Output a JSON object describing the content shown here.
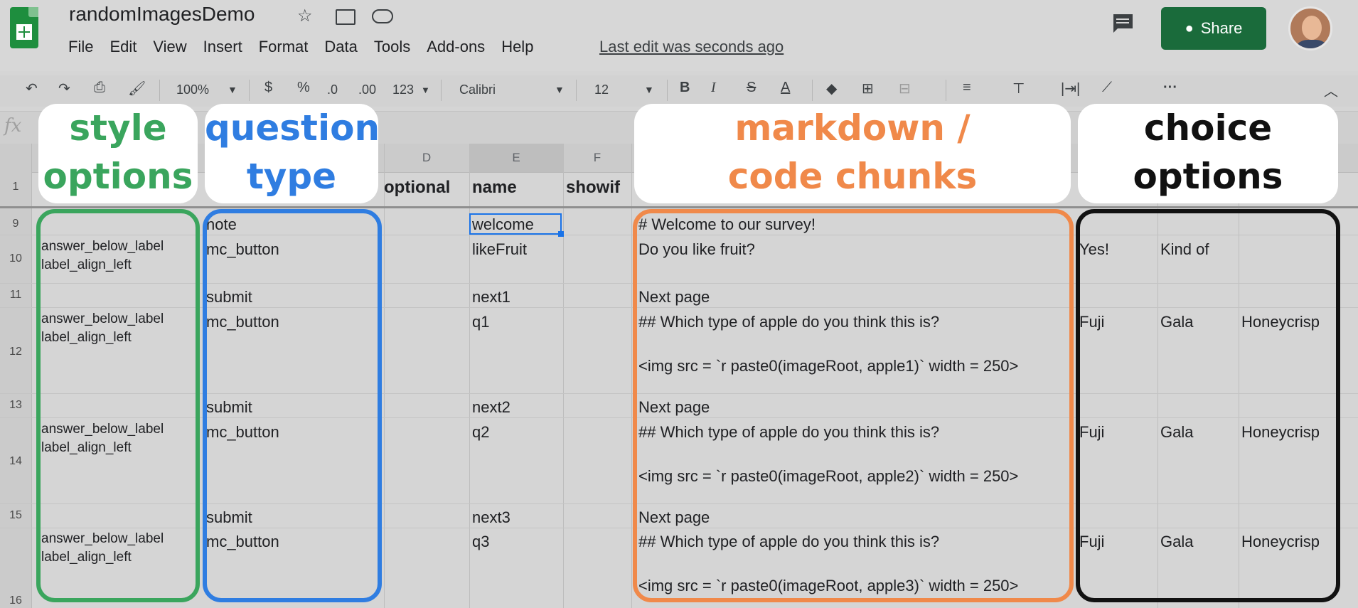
{
  "app": {
    "title": "randomImagesDemo",
    "menu": [
      "File",
      "Edit",
      "View",
      "Insert",
      "Format",
      "Data",
      "Tools",
      "Add-ons",
      "Help"
    ],
    "last_edit": "Last edit was seconds ago",
    "share_label": "Share"
  },
  "toolbar": {
    "zoom": "100%",
    "currency": "$",
    "percent": "%",
    "dec_less": ".0",
    "dec_more": ".00",
    "format_more": "123",
    "font": "Calibri",
    "font_size": "12",
    "more": "···"
  },
  "formula_bar": {
    "fx": "fx"
  },
  "columns": {
    "D": "D",
    "E": "E",
    "F": "F"
  },
  "header_row": {
    "num": "1",
    "optional": "optional",
    "name": "name",
    "showif": "showif"
  },
  "rows": [
    {
      "num": "9",
      "style": "",
      "type": "note",
      "name": "welcome",
      "md": "# Welcome to our survey!",
      "md2": "",
      "c1": "",
      "c2": "",
      "c3": ""
    },
    {
      "num": "10",
      "style": "answer_below_label\nlabel_align_left",
      "type": "mc_button",
      "name": "likeFruit",
      "md": "Do you like fruit?",
      "md2": "",
      "c1": "Yes!",
      "c2": "Kind of",
      "c3": ""
    },
    {
      "num": "11",
      "style": "",
      "type": "submit",
      "name": "next1",
      "md": "Next page",
      "md2": "",
      "c1": "",
      "c2": "",
      "c3": ""
    },
    {
      "num": "12",
      "style": "answer_below_label\nlabel_align_left",
      "type": "mc_button",
      "name": "q1",
      "md": "## Which type of apple do you think this is?",
      "md2": "<img src = `r paste0(imageRoot, apple1)` width = 250>",
      "c1": "Fuji",
      "c2": "Gala",
      "c3": "Honeycrisp"
    },
    {
      "num": "13",
      "style": "",
      "type": "submit",
      "name": "next2",
      "md": "Next page",
      "md2": "",
      "c1": "",
      "c2": "",
      "c3": ""
    },
    {
      "num": "14",
      "style": "answer_below_label\nlabel_align_left",
      "type": "mc_button",
      "name": "q2",
      "md": "## Which type of apple do you think this is?",
      "md2": "<img src = `r paste0(imageRoot, apple2)` width = 250>",
      "c1": "Fuji",
      "c2": "Gala",
      "c3": "Honeycrisp"
    },
    {
      "num": "15",
      "style": "",
      "type": "submit",
      "name": "next3",
      "md": "Next page",
      "md2": "",
      "c1": "",
      "c2": "",
      "c3": ""
    },
    {
      "num": "16",
      "style": "answer_below_label\nlabel_align_left",
      "type": "mc_button",
      "name": "q3",
      "md": "## Which type of apple do you think this is?",
      "md2": "<img src = `r paste0(imageRoot, apple3)` width = 250>",
      "c1": "Fuji",
      "c2": "Gala",
      "c3": "Honeycrisp"
    }
  ],
  "overlays": {
    "style": {
      "line1": "style",
      "line2": "options",
      "color": "#3aa55d"
    },
    "question": {
      "line1": "question",
      "line2": "type",
      "color": "#2f7de1"
    },
    "markdown": {
      "line1": "markdown /",
      "line2": "code chunks",
      "color": "#f0894a"
    },
    "choice": {
      "line1": "choice",
      "line2": "options",
      "color": "#111111"
    }
  }
}
